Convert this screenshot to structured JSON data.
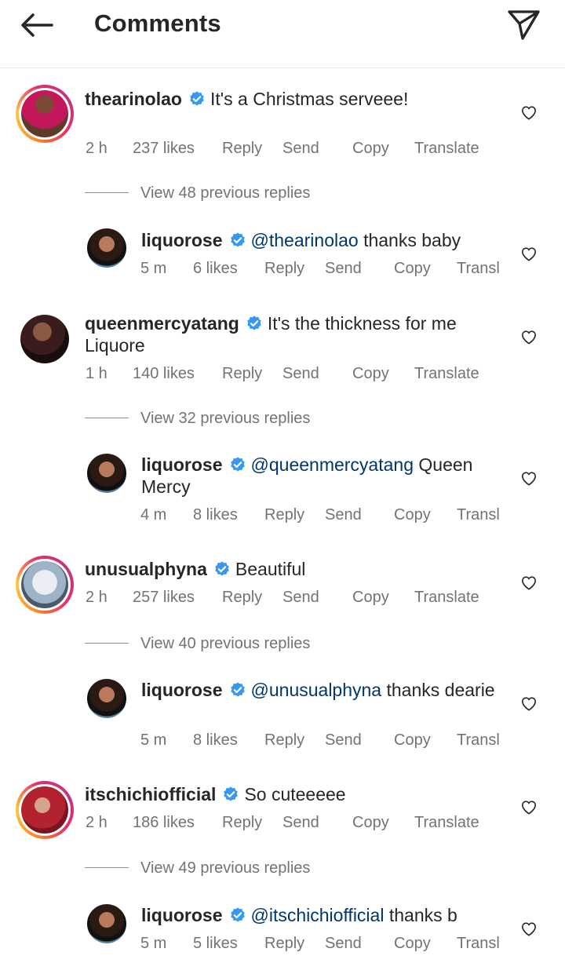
{
  "header": {
    "title": "Comments"
  },
  "icons": {
    "back": "arrow-left-icon",
    "share": "paper-plane-icon",
    "heart": "heart-outline-icon",
    "verified": "verified-badge-icon"
  },
  "colors": {
    "verified": "#3897f0",
    "mention": "#00376b",
    "meta": "#737373"
  },
  "comments": [
    {
      "user": "thearinolao",
      "text": "It's a Christmas serveee!",
      "time": "2 h",
      "likes": "237 likes",
      "reply": "Reply",
      "send": "Send",
      "copy": "Copy",
      "translate": "Translate",
      "view_replies": "View 48 previous replies",
      "reply_item": {
        "user": "liquorose",
        "mention": "@thearinolao",
        "text": " thanks baby",
        "time": "5 m",
        "likes": "6 likes",
        "reply": "Reply",
        "send": "Send",
        "copy": "Copy",
        "translate": "Transl"
      }
    },
    {
      "user": "queenmercyatang",
      "text": "It's the thickness for me",
      "text2": "Liquore",
      "time": "1 h",
      "likes": "140 likes",
      "reply": "Reply",
      "send": "Send",
      "copy": "Copy",
      "translate": "Translate",
      "view_replies": "View 32 previous replies",
      "reply_item": {
        "user": "liquorose",
        "mention": "@queenmercyatang",
        "text": " Queen",
        "text2": "Mercy",
        "time": "4 m",
        "likes": "8 likes",
        "reply": "Reply",
        "send": "Send",
        "copy": "Copy",
        "translate": "Transl"
      }
    },
    {
      "user": "unusualphyna",
      "text": "Beautiful",
      "time": "2 h",
      "likes": "257 likes",
      "reply": "Reply",
      "send": "Send",
      "copy": "Copy",
      "translate": "Translate",
      "view_replies": "View 40 previous replies",
      "reply_item": {
        "user": "liquorose",
        "mention": "@unusualphyna",
        "text": " thanks dearie",
        "time": "5 m",
        "likes": "8 likes",
        "reply": "Reply",
        "send": "Send",
        "copy": "Copy",
        "translate": "Transl"
      }
    },
    {
      "user": "itschichiofficial",
      "text": "So cuteeeee",
      "time": "2 h",
      "likes": "186 likes",
      "reply": "Reply",
      "send": "Send",
      "copy": "Copy",
      "translate": "Translate",
      "view_replies": "View 49 previous replies",
      "reply_item": {
        "user": "liquorose",
        "mention": "@itschichiofficial",
        "text": " thanks b",
        "time": "5 m",
        "likes": "5 likes",
        "reply": "Reply",
        "send": "Send",
        "copy": "Copy",
        "translate": "Transl"
      }
    }
  ]
}
